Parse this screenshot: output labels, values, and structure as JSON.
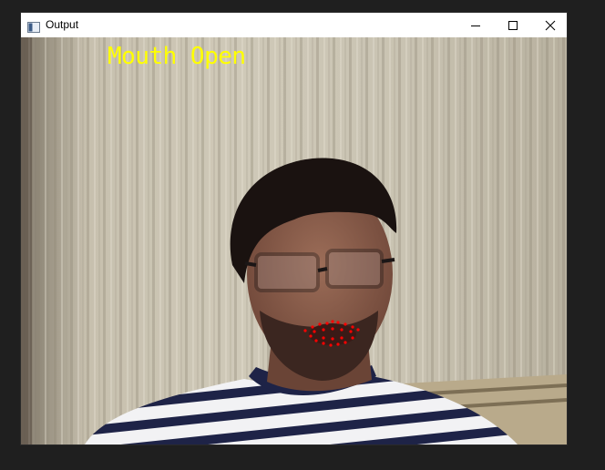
{
  "window": {
    "title": "Output",
    "controls": [
      "minimize",
      "maximize",
      "close"
    ]
  },
  "frame": {
    "overlay_text": "Mouth Open",
    "overlay_color": "#ffff00",
    "landmark_color": "#ff0000"
  }
}
